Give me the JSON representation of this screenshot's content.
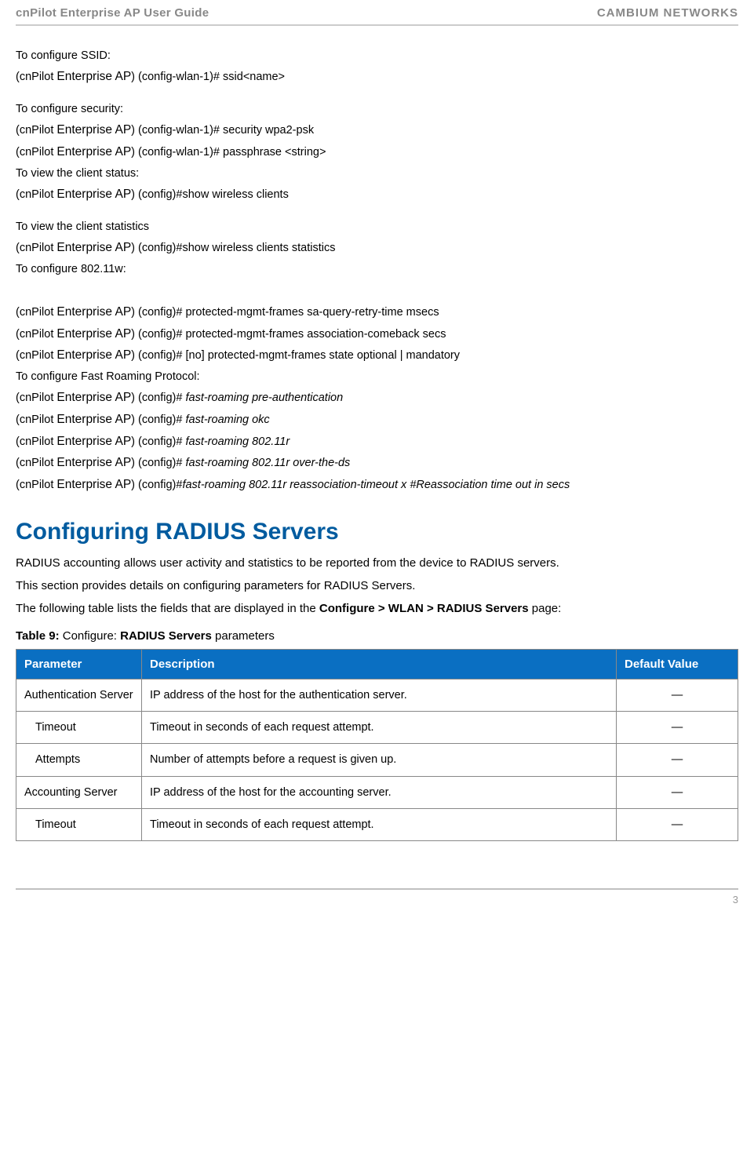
{
  "header": {
    "left": "cnPilot Enterprise AP User Guide",
    "right": "CAMBIUM NETWORKS"
  },
  "cli": {
    "brand_prefix": "(cnPilot ",
    "brand_name": "Enterprise AP",
    "brand_suffix": ") ",
    "intro_ssid": "To configure SSID:",
    "ssid_context": "(config-wlan-1)# ",
    "ssid_cmd": "ssid<name>",
    "intro_security": "To configure security:",
    "security_context": "(config-wlan-1)# ",
    "security_cmd": "security wpa2-psk",
    "passphrase_context": "(config-wlan-1)# ",
    "passphrase_cmd": "passphrase <string>",
    "intro_client_status": "To view the client status:",
    "client_status_context": "(config)#",
    "client_status_cmd": "show wireless clients",
    "intro_client_stats": "To view the client statistics",
    "client_stats_context": "(config)#",
    "client_stats_cmd": "show wireless clients statistics",
    "intro_80211w": "To configure 802.11w:",
    "config_context": "(config)# ",
    "pmf_sa_query": "protected-mgmt-frames  sa-query-retry-time  msecs",
    "pmf_assoc": "protected-mgmt-frames association-comeback  secs",
    "pmf_state": "[no] protected-mgmt-frames state optional | mandatory",
    "intro_fast_roaming": "To configure Fast Roaming Protocol:",
    "fr_preauth": "fast-roaming pre-authentication",
    "fr_okc": "fast-roaming okc",
    "fr_80211r": "fast-roaming 802.11r",
    "fr_overds": "fast-roaming 802.11r over-the-ds",
    "fr_reassoc": "fast-roaming 802.11r reassociation-timeout x #Reassociation time out in secs",
    "brand_name_tight": "Enterprise AP",
    "config_context_tight": "(config)#"
  },
  "radius": {
    "heading": "Configuring RADIUS Servers",
    "p1": "RADIUS accounting allows user activity and statistics to be reported from the device to RADIUS servers.",
    "p2": "This section provides details on configuring parameters for RADIUS Servers.",
    "p3_pre": "The following table lists the fields that are displayed in the ",
    "p3_bold": "Configure > WLAN > RADIUS Servers",
    "p3_post": " page:",
    "table_caption_pre": "Table 9: ",
    "table_caption_mid": "Configure: ",
    "table_caption_bold": "RADIUS Servers",
    "table_caption_post": " parameters"
  },
  "table": {
    "headers": {
      "param": "Parameter",
      "desc": "Description",
      "default": "Default Value"
    },
    "rows": [
      {
        "param": "Authentication Server",
        "desc": "IP address of the host for the authentication server.",
        "default": "—",
        "indent": false
      },
      {
        "param": "Timeout",
        "desc": "Timeout in seconds of each request attempt.",
        "default": "—",
        "indent": true
      },
      {
        "param": "Attempts",
        "desc": "Number of attempts before a request is given up.",
        "default": "—",
        "indent": true
      },
      {
        "param": "Accounting Server",
        "desc": "IP address of the host for the accounting server.",
        "default": "—",
        "indent": false
      },
      {
        "param": "Timeout",
        "desc": "Timeout in seconds of each request attempt.",
        "default": "—",
        "indent": true
      }
    ]
  },
  "footer": {
    "page": "3"
  }
}
